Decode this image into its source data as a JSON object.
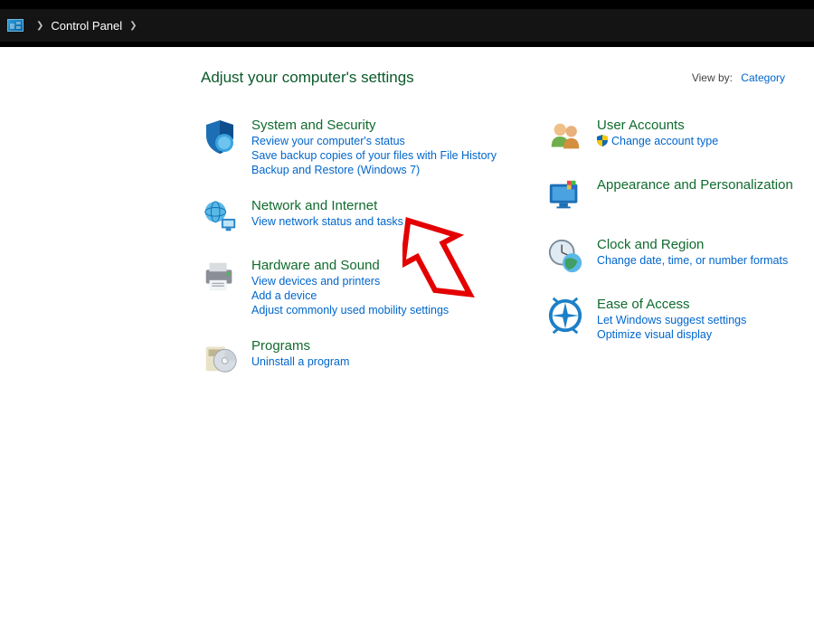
{
  "breadcrumb": {
    "root": "Control Panel"
  },
  "heading": "Adjust your computer's settings",
  "viewby": {
    "label": "View by:",
    "value": "Category"
  },
  "left": [
    {
      "title": "System and Security",
      "links": [
        "Review your computer's status",
        "Save backup copies of your files with File History",
        "Backup and Restore (Windows 7)"
      ]
    },
    {
      "title": "Network and Internet",
      "links": [
        "View network status and tasks"
      ]
    },
    {
      "title": "Hardware and Sound",
      "links": [
        "View devices and printers",
        "Add a device",
        "Adjust commonly used mobility settings"
      ]
    },
    {
      "title": "Programs",
      "links": [
        "Uninstall a program"
      ]
    }
  ],
  "right": [
    {
      "title": "User Accounts",
      "links": [
        "Change account type"
      ],
      "shield": [
        true
      ]
    },
    {
      "title": "Appearance and Personalization",
      "links": []
    },
    {
      "title": "Clock and Region",
      "links": [
        "Change date, time, or number formats"
      ]
    },
    {
      "title": "Ease of Access",
      "links": [
        "Let Windows suggest settings",
        "Optimize visual display"
      ]
    }
  ]
}
